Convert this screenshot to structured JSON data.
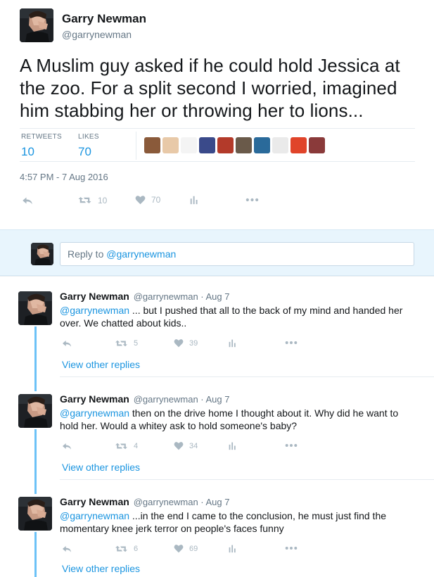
{
  "tweet": {
    "author_name": "Garry Newman",
    "author_handle": "@garrynewman",
    "text": "A Muslim guy asked if he could hold Jessica at the zoo. For a split second I worried, imagined him stabbing her or throwing her to lions...",
    "retweets_label": "RETWEETS",
    "retweets_count": "10",
    "likes_label": "LIKES",
    "likes_count": "70",
    "timestamp": "4:57 PM - 7 Aug 2016",
    "actions": {
      "retweet_count": "10",
      "like_count": "70"
    },
    "liker_colors": [
      "#8a5a3a",
      "#e8c9a8",
      "#f4f4f4",
      "#3a4a8a",
      "#b33a2a",
      "#6a5a4a",
      "#2a6a9a",
      "#eaeaea",
      "#e0442a",
      "#8a3a3a"
    ]
  },
  "reply_box": {
    "placeholder_prefix": "Reply to ",
    "placeholder_mention": "@garrynewman"
  },
  "replies": [
    {
      "name": "Garry Newman",
      "handle_meta": "@garrynewman · Aug 7",
      "mention": "@garrynewman",
      "text": " ... but I pushed that all to the back of my mind and handed her over. We chatted about kids..",
      "retweet_count": "5",
      "like_count": "39",
      "view_replies": "View other replies"
    },
    {
      "name": "Garry Newman",
      "handle_meta": "@garrynewman · Aug 7",
      "mention": "@garrynewman",
      "text": " then on the drive home I thought about it. Why did he want to hold her. Would a whitey ask to hold someone's baby?",
      "retweet_count": "4",
      "like_count": "34",
      "view_replies": "View other replies"
    },
    {
      "name": "Garry Newman",
      "handle_meta": "@garrynewman · Aug 7",
      "mention": "@garrynewman",
      "text": " ...in the end I came to the conclusion, he must just find the momentary knee jerk terror on people's faces funny",
      "retweet_count": "6",
      "like_count": "69",
      "view_replies": "View other replies"
    }
  ],
  "colors": {
    "accent": "#1b95e0",
    "muted": "#657786",
    "icon": "#aab8c2",
    "reply_bg": "#e8f5fd"
  }
}
